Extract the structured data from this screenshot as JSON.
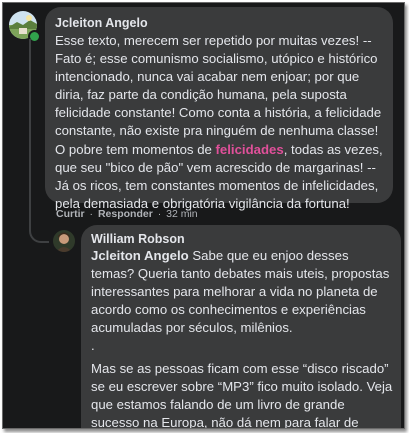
{
  "comment1": {
    "author": "Jcleiton Angelo",
    "text_before": "Esse texto, merecem ser repetido por muitas vezes! -- Fato é; esse comunismo socialismo, utópico e histórico intencionado, nunca vai acabar nem enjoar; por que diria, faz parte da condição humana, pela suposta felicidade constante! Como conta a história, a felicidade constante, não existe pra ninguém de nenhuma classe! O pobre tem momentos de ",
    "highlight": "felicidades",
    "text_after": ", todas as vezes, que seu \"bico de pão\" vem acrescido de margarinas! -- Já os ricos, tem constantes momentos de infelicidades, pela demasiada e obrigatória vigilância da fortuna!",
    "actions": {
      "like": "Curtir",
      "reply": "Responder",
      "separator": "·",
      "time": "32 min"
    },
    "avatar_icon": "landscape-avatar",
    "online": true
  },
  "comment2": {
    "author": "William Robson",
    "mention": "Jcleiton Angelo",
    "p1": " Sabe que eu enjoo desses temas? Queria tanto debates mais uteis, propostas interessantes para melhorar a vida no planeta de acordo como os conhecimentos e experiências acumuladas por séculos, milênios.",
    "p2": ".",
    "p3": "Mas se as pessoas ficam com esse “disco riscado” se eu escrever sobre “MP3” fico muito isolado. Veja que estamos falando de um livro de grande sucesso na Europa, não dá nem para falar de “complexo de vira lata”...",
    "avatar_icon": "person-avatar"
  },
  "colors": {
    "background": "#18191a",
    "bubble": "#3a3b3c",
    "text": "#e4e6eb",
    "muted": "#b0b3b8",
    "highlight": "#e0509a",
    "online": "#31a24c"
  }
}
